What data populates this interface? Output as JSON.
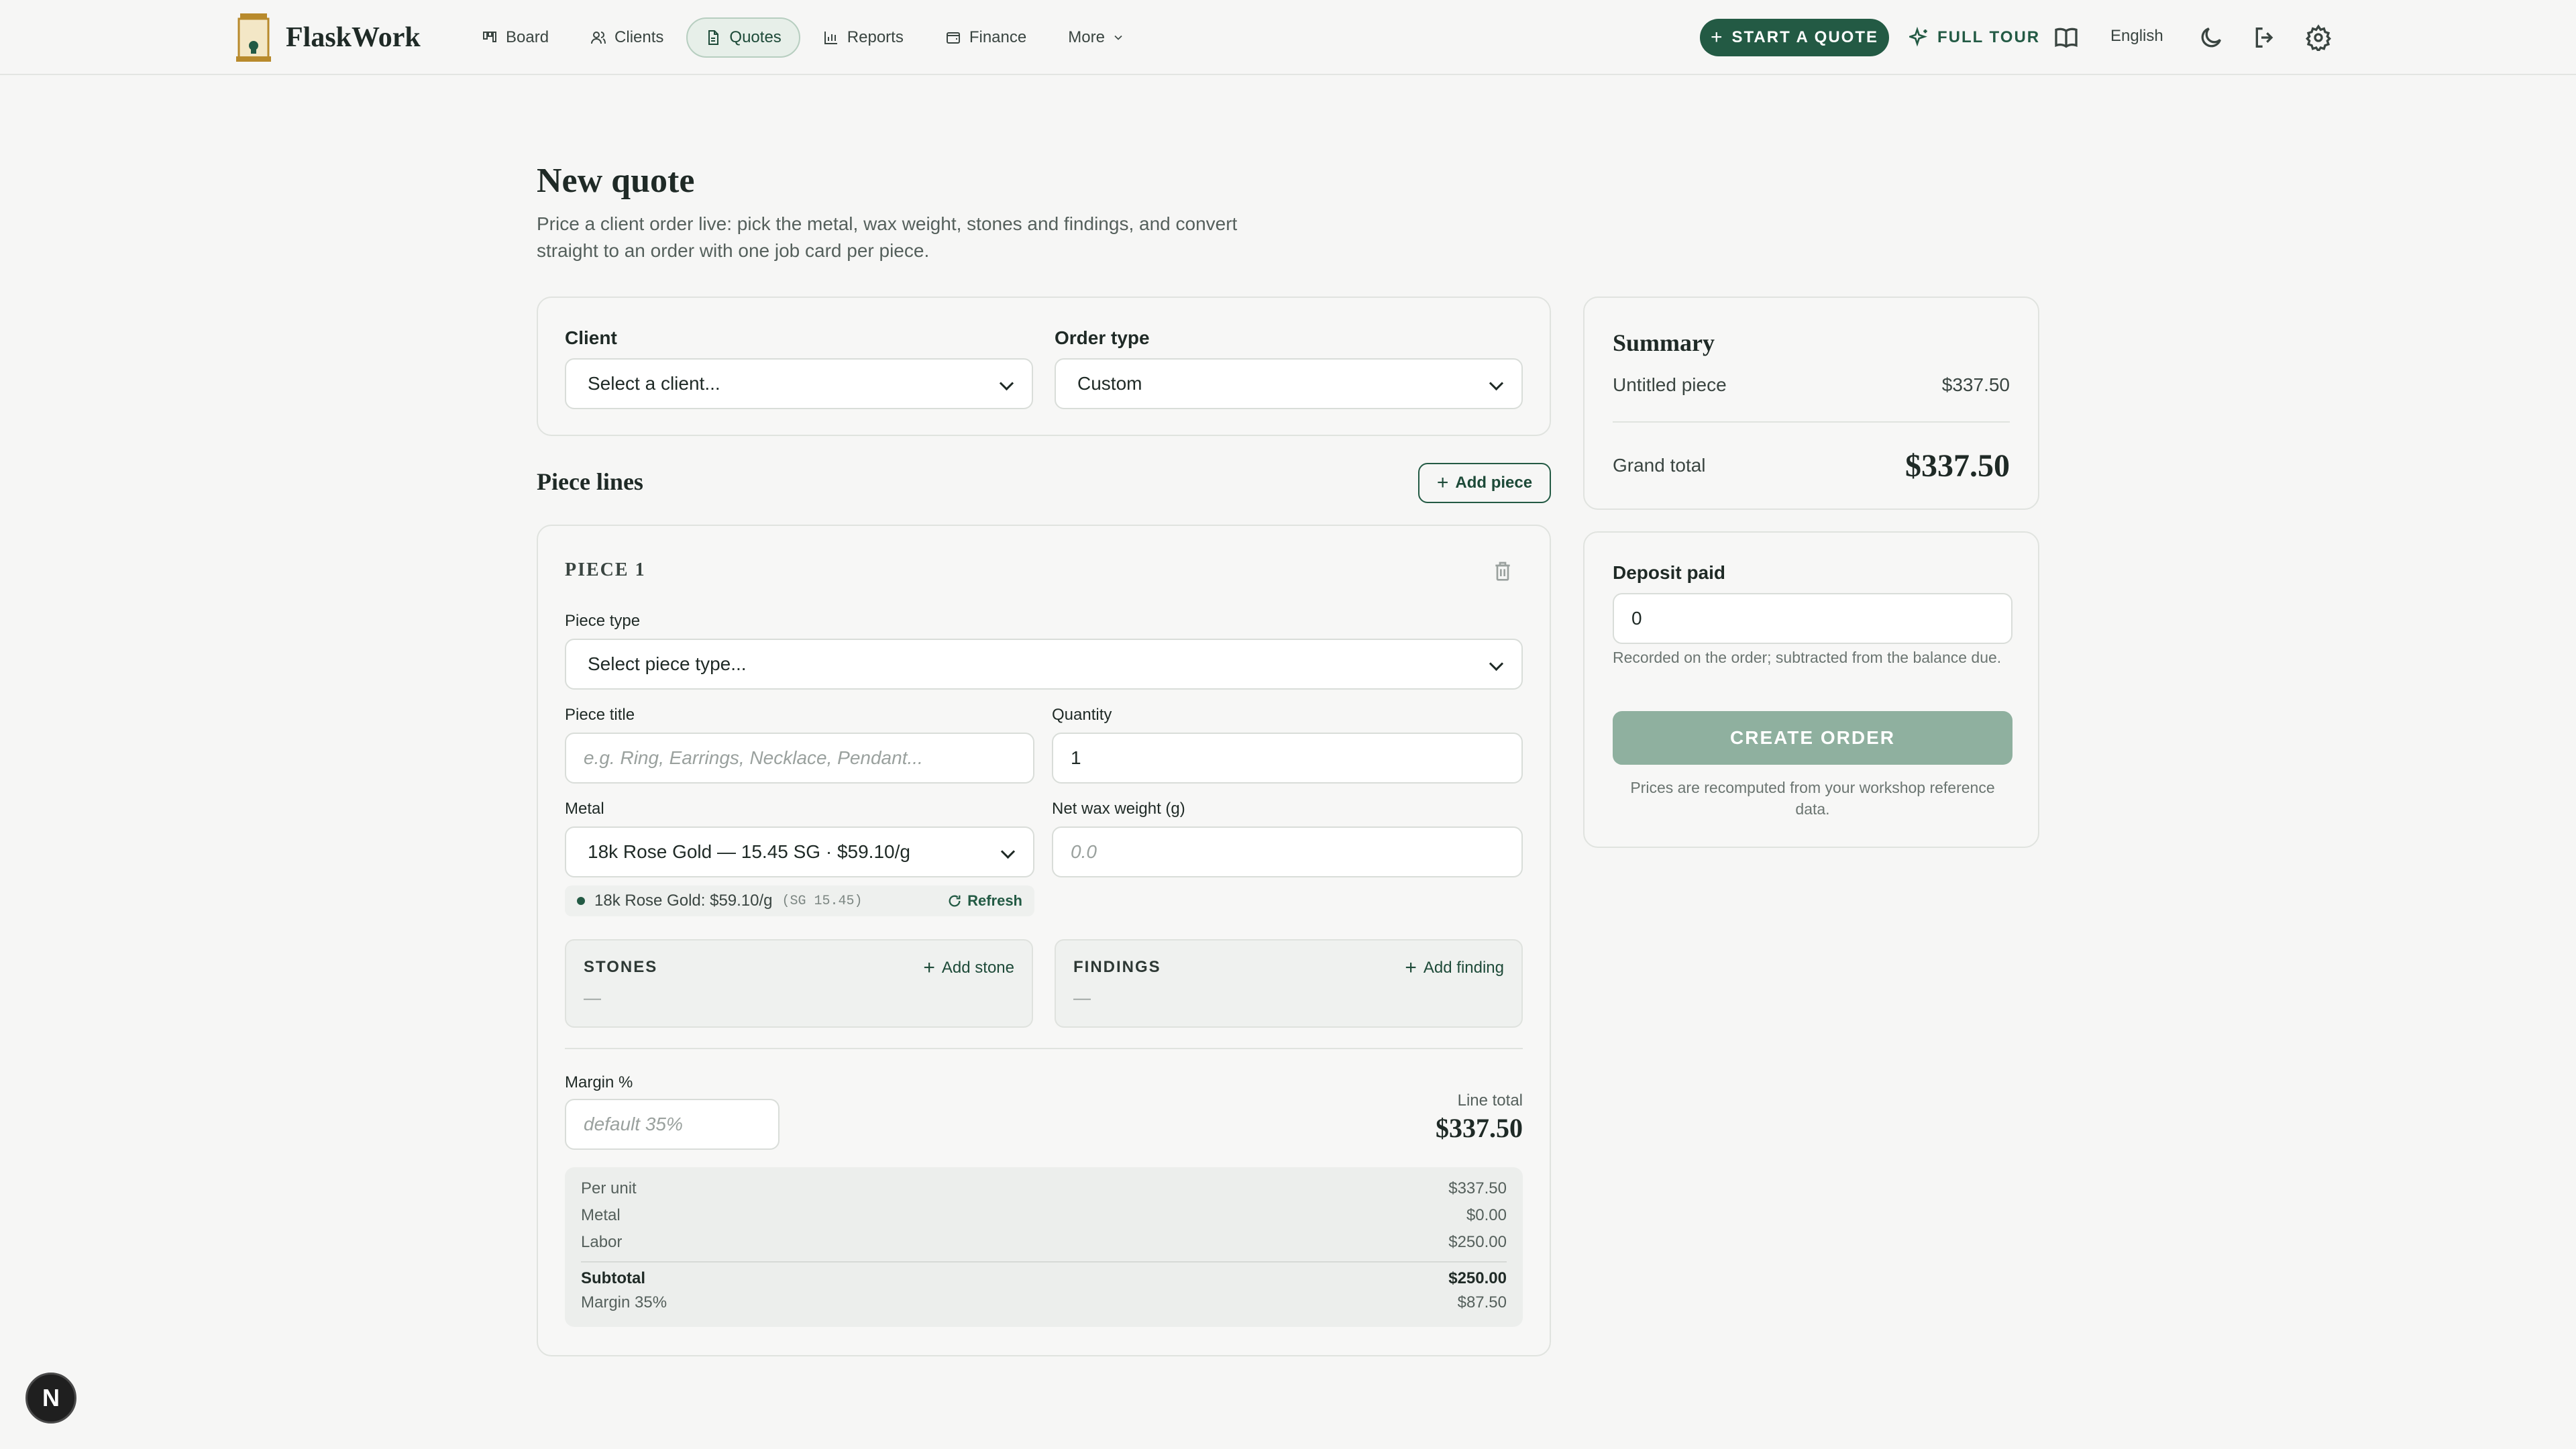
{
  "brand": {
    "name": "FlaskWork"
  },
  "nav": {
    "items": [
      {
        "label": "Board",
        "icon": "board-icon"
      },
      {
        "label": "Clients",
        "icon": "users-icon"
      },
      {
        "label": "Quotes",
        "icon": "document-icon",
        "active": true
      },
      {
        "label": "Reports",
        "icon": "bar-chart-icon"
      },
      {
        "label": "Finance",
        "icon": "wallet-icon"
      },
      {
        "label": "More",
        "icon": "chevron-down-icon"
      }
    ],
    "start_quote": "START A QUOTE",
    "tour": "FULL  TOUR",
    "language": "English"
  },
  "page": {
    "title": "New quote",
    "subtitle": "Price a client order live: pick the metal, wax weight, stones and findings, and convert straight to an order with one job card per piece."
  },
  "order": {
    "client_label": "Client",
    "client_value": "Select a client...",
    "type_label": "Order type",
    "type_value": "Custom"
  },
  "pieces": {
    "section_title": "Piece lines",
    "add_piece": "Add piece",
    "piece": {
      "header": "PIECE 1",
      "piece_type_label": "Piece type",
      "piece_type_value": "Select piece type...",
      "title_label": "Piece title",
      "title_placeholder": "e.g. Ring, Earrings, Necklace, Pendant...",
      "quantity_label": "Quantity",
      "quantity_value": "1",
      "metal_label": "Metal",
      "metal_value": "18k Rose Gold — 15.45 SG · $59.10/g",
      "wax_label": "Net wax weight (g)",
      "wax_placeholder": "0.0",
      "rate_text": "18k Rose Gold: $59.10/g",
      "rate_sg": "(SG 15.45)",
      "refresh": "Refresh",
      "stones_title": "STONES",
      "stones_add": "Add stone",
      "stones_empty": "—",
      "findings_title": "FINDINGS",
      "findings_add": "Add finding",
      "findings_empty": "—",
      "margin_label": "Margin %",
      "margin_placeholder": "default 35%",
      "line_total_label": "Line total",
      "line_total": "$337.50",
      "breakdown": {
        "per_unit_label": "Per unit",
        "per_unit": "$337.50",
        "metal_label": "Metal",
        "metal": "$0.00",
        "labor_label": "Labor",
        "labor": "$250.00",
        "subtotal_label": "Subtotal",
        "subtotal": "$250.00",
        "margin_label": "Margin 35%",
        "margin": "$87.50"
      }
    }
  },
  "summary": {
    "title": "Summary",
    "item_label": "Untitled piece",
    "item_value": "$337.50",
    "grand_label": "Grand total",
    "grand_value": "$337.50"
  },
  "deposit": {
    "label": "Deposit paid",
    "value": "0",
    "hint": "Recorded on the order; subtracted from the balance due.",
    "create": "CREATE ORDER",
    "footnote": "Prices are recomputed from your workshop reference data."
  },
  "fab": {
    "label": "N"
  },
  "colors": {
    "accent": "#235a44",
    "disabled_button": "#8fb09f",
    "background": "#f6f6f5"
  }
}
